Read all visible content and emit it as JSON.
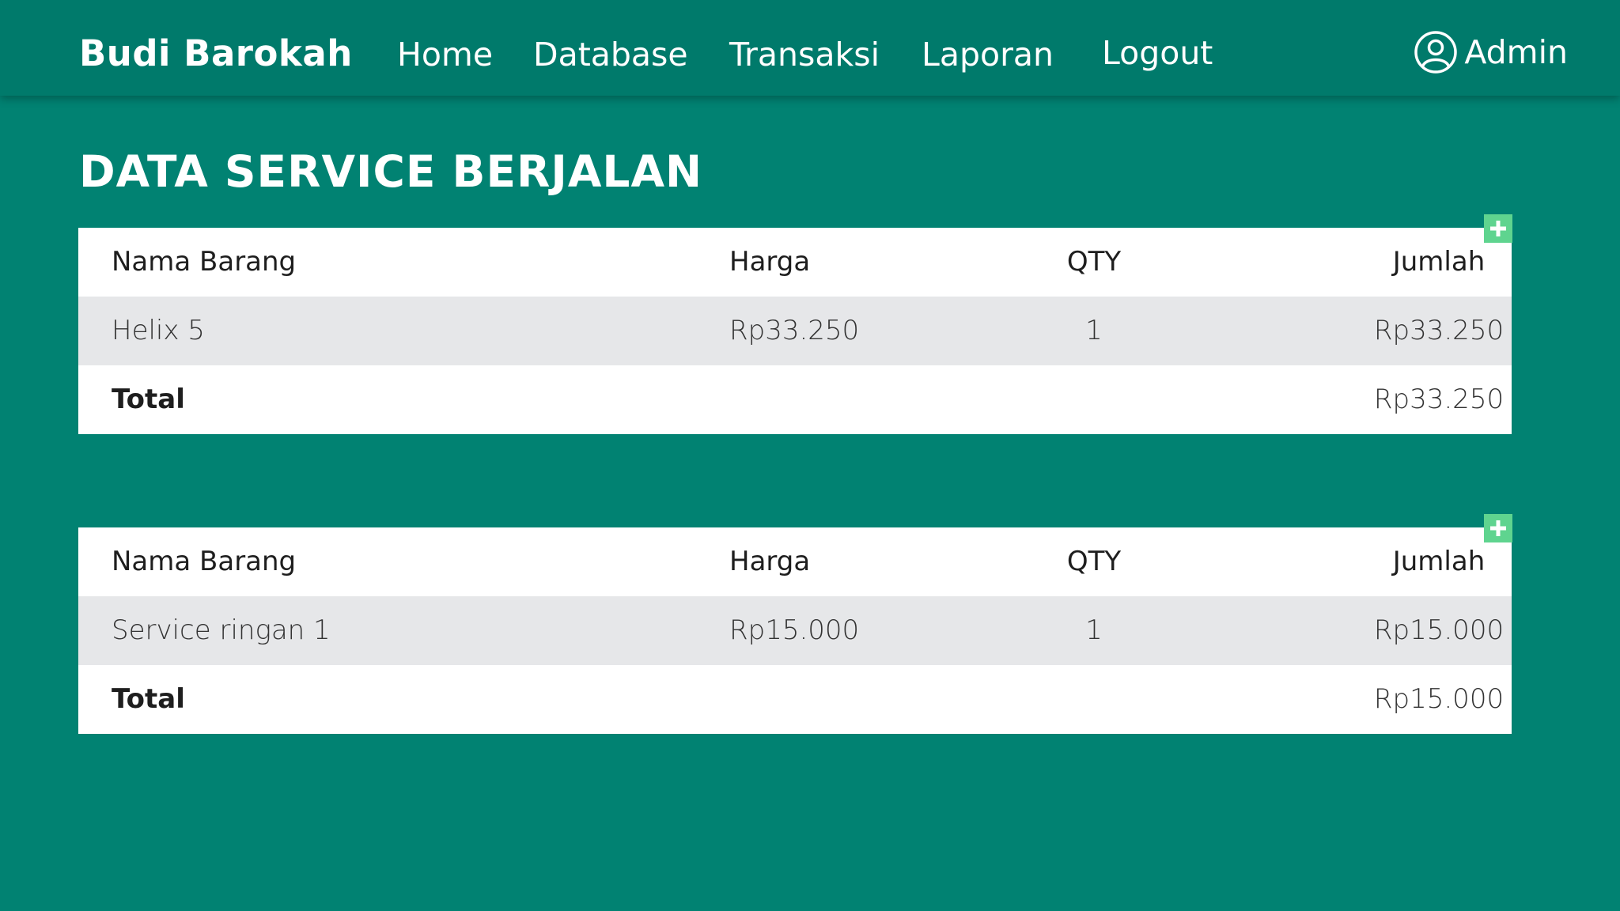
{
  "navbar": {
    "brand": "Budi Barokah",
    "items": [
      {
        "label": "Home"
      },
      {
        "label": "Database"
      },
      {
        "label": "Transaksi"
      },
      {
        "label": "Laporan"
      },
      {
        "label": "Logout"
      }
    ],
    "user_label": "Admin",
    "user_icon": "user-circle-icon"
  },
  "page": {
    "title": "DATA SERVICE BERJALAN"
  },
  "tables": [
    {
      "headers": [
        "Nama Barang",
        "Harga",
        "QTY",
        "Jumlah"
      ],
      "rows": [
        {
          "name": "Helix 5",
          "price": "Rp33.250",
          "qty": "1",
          "sum": "Rp33.250"
        }
      ],
      "total_label": "Total",
      "total_value": "Rp33.250",
      "add_icon": "plus-icon"
    },
    {
      "headers": [
        "Nama Barang",
        "Harga",
        "QTY",
        "Jumlah"
      ],
      "rows": [
        {
          "name": "Service ringan 1",
          "price": "Rp15.000",
          "qty": "1",
          "sum": "Rp15.000"
        }
      ],
      "total_label": "Total",
      "total_value": "Rp15.000",
      "add_icon": "plus-icon"
    }
  ],
  "colors": {
    "background": "#018272",
    "navbar": "#007a6b",
    "add_button": "#5fd48f",
    "row_alt": "#e6e7e9"
  }
}
